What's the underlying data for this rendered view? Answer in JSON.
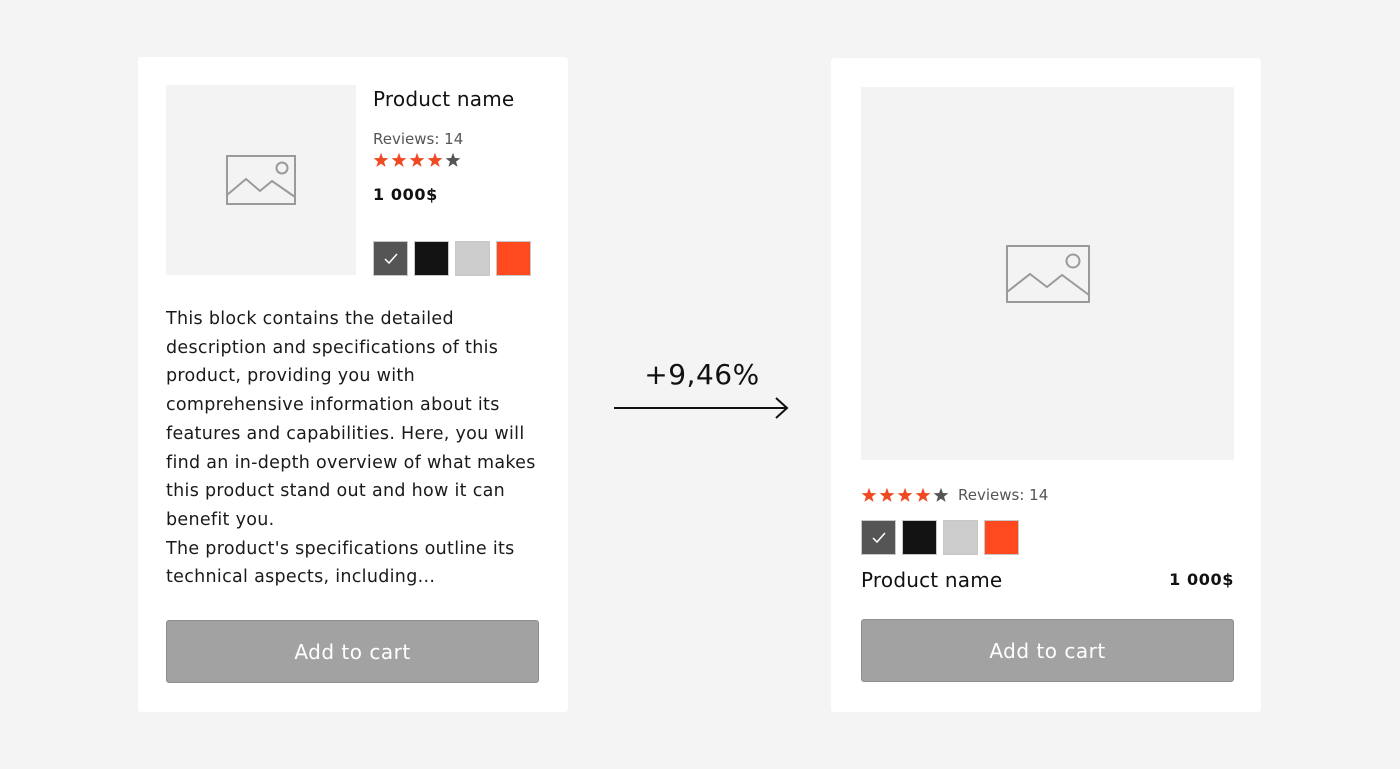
{
  "variant_a": {
    "product_name": "Product name",
    "reviews": "Reviews: 14",
    "rating": 4,
    "rating_max": 5,
    "price": "1 000$",
    "swatches": [
      {
        "color": "#555555",
        "selected": true
      },
      {
        "color": "#131313",
        "selected": false
      },
      {
        "color": "#cccccc",
        "selected": false
      },
      {
        "color": "#ff4a1f",
        "selected": false
      }
    ],
    "description": [
      "This block contains the detailed description and specifications of this product, providing you with comprehensive information about its features and capabilities. Here, you will find an in-depth overview of what makes this product stand out and how it can benefit you.",
      "The product's specifications outline its technical aspects, including..."
    ],
    "cart_button": "Add to cart"
  },
  "uplift": "+9,46%",
  "variant_b": {
    "product_name": "Product name",
    "reviews": "Reviews: 14",
    "rating": 4,
    "rating_max": 5,
    "price": "1 000$",
    "swatches": [
      {
        "color": "#555555",
        "selected": true
      },
      {
        "color": "#131313",
        "selected": false
      },
      {
        "color": "#cccccc",
        "selected": false
      },
      {
        "color": "#ff4a1f",
        "selected": false
      }
    ],
    "cart_button": "Add to cart"
  },
  "colors": {
    "star_filled": "#f04a25",
    "star_empty": "#555555",
    "button_bg": "#a2a2a2",
    "placeholder_bg": "#f3f3f3",
    "page_bg": "#f4f4f4"
  },
  "icons": {
    "image_placeholder": "image-icon",
    "selected_swatch": "check-icon",
    "direction": "arrow-right-icon"
  }
}
